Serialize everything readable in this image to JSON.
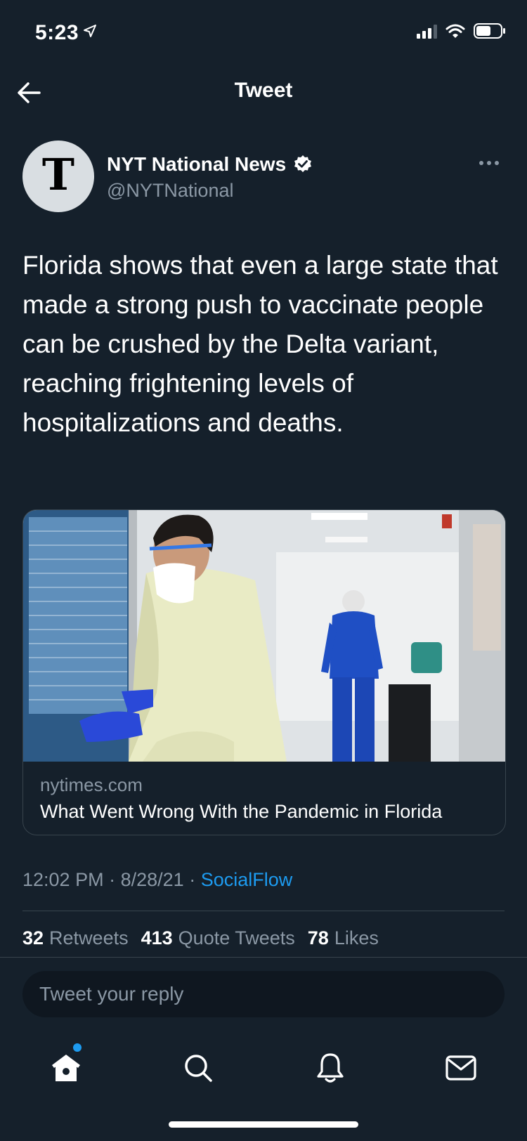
{
  "status_bar": {
    "time": "5:23"
  },
  "nav": {
    "title": "Tweet"
  },
  "author": {
    "name": "NYT National News",
    "handle": "@NYTNational",
    "avatar_letter": "T"
  },
  "tweet": {
    "text": "Florida shows that even a large state that made a strong push to vaccinate people can be crushed by the Delta variant, reaching frightening levels of hospitalizations and deaths."
  },
  "card": {
    "domain": "nytimes.com",
    "title": "What Went Wrong With the Pandemic in Florida"
  },
  "meta": {
    "time": "12:02 PM",
    "date": "8/28/21",
    "separator": "·",
    "source": "SocialFlow"
  },
  "stats": [
    {
      "count": "32",
      "label": "Retweets"
    },
    {
      "count": "413",
      "label": "Quote Tweets"
    },
    {
      "count": "78",
      "label": "Likes"
    }
  ],
  "reply": {
    "placeholder": "Tweet your reply"
  },
  "tabs": [
    "home-icon",
    "search-icon",
    "notifications-icon",
    "messages-icon"
  ],
  "colors": {
    "background": "#15202b",
    "accent": "#1d9bf0",
    "muted": "#8b98a5",
    "border": "#38444d"
  }
}
